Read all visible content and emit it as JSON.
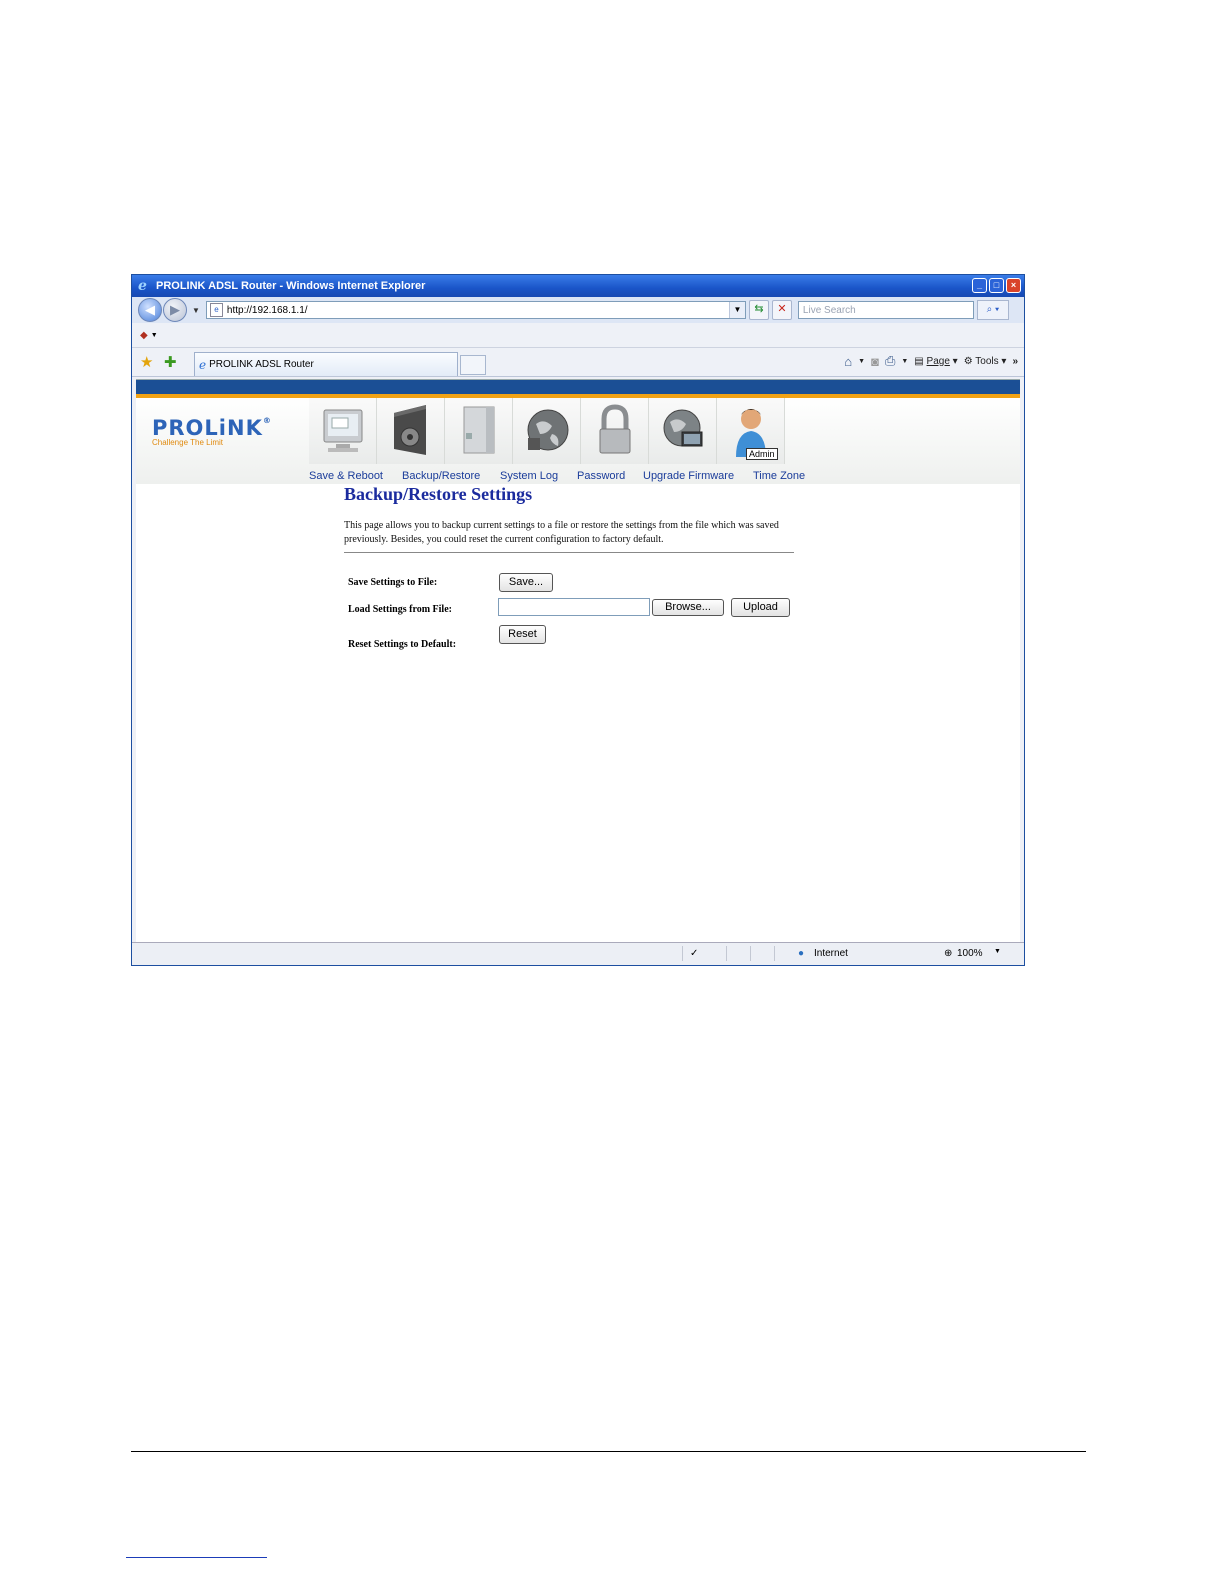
{
  "window": {
    "title": "PROLINK ADSL Router - Windows Internet Explorer",
    "url": "http://192.168.1.1/",
    "search_placeholder": "Live Search",
    "tab_title": "PROLINK ADSL Router",
    "cmd_page": "Page",
    "cmd_tools": "Tools",
    "status_zone": "Internet",
    "zoom": "100%"
  },
  "router": {
    "logo_word": "PROLiNK",
    "logo_tagline": "Challenge The Limit",
    "tooltip": "Admin",
    "nav": [
      "Save & Reboot",
      "Backup/Restore",
      "System Log",
      "Password",
      "Upgrade Firmware",
      "Time Zone"
    ]
  },
  "content": {
    "heading": "Backup/Restore Settings",
    "description": "This page allows you to backup current settings to a file or restore the settings from the file which was saved previously. Besides, you could reset the current configuration to factory default.",
    "save_label": "Save Settings to File:",
    "load_label": "Load Settings from File:",
    "reset_label": "Reset Settings to Default:",
    "save_btn": "Save...",
    "browse_btn": "Browse...",
    "upload_btn": "Upload",
    "reset_btn": "Reset"
  },
  "colors": {
    "title_blue": "#1b2b9e",
    "nav_blue": "#1a3c9a",
    "header_bar": "#1b4f95",
    "accent_orange": "#f1a215"
  }
}
